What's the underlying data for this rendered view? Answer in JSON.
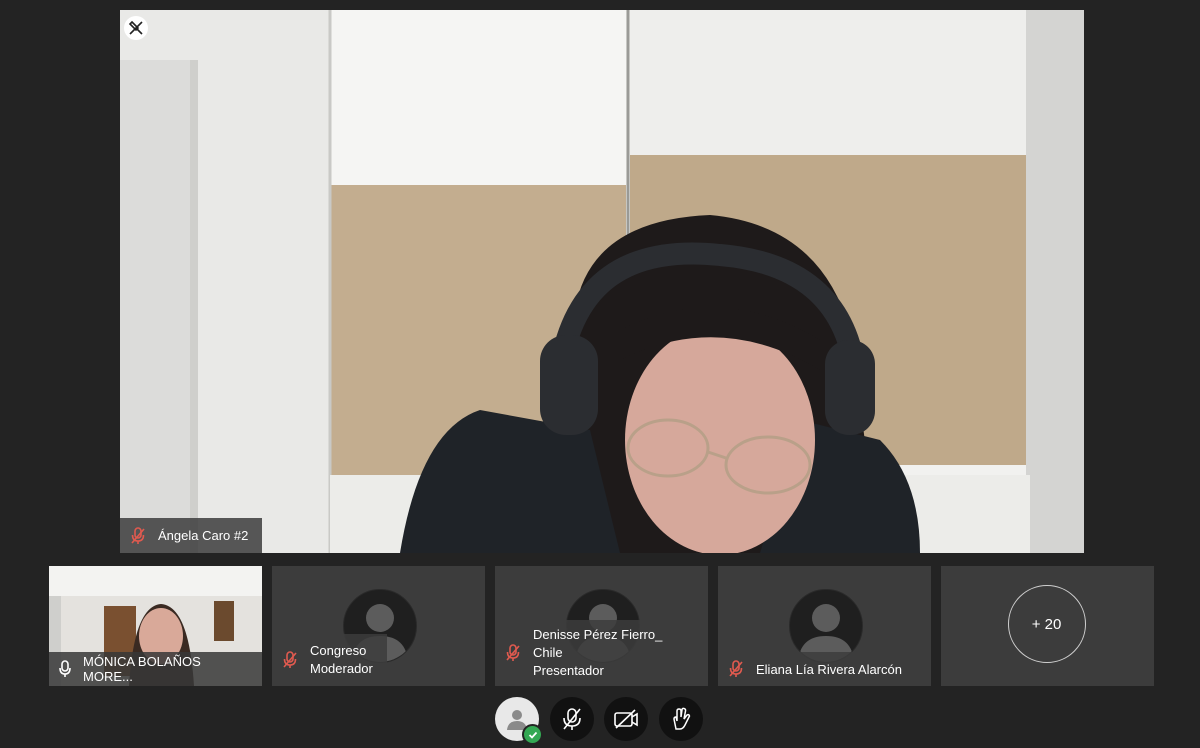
{
  "main_speaker": {
    "name": "Ángela Caro #2",
    "mic_muted": true
  },
  "participants": [
    {
      "name": "MÓNICA BOLAÑOS MORE...",
      "role": "",
      "mic_muted": false,
      "has_video": true
    },
    {
      "name": "Congreso",
      "role": "Moderador",
      "mic_muted": true,
      "has_video": false
    },
    {
      "name": "Denisse Pérez Fierro_ Chile",
      "role": "Presentador",
      "mic_muted": true,
      "has_video": false
    },
    {
      "name": "Eliana Lía Rivera Alarcón",
      "role": "",
      "mic_muted": true,
      "has_video": false
    }
  ],
  "more_participants": "+ 20",
  "controls": {
    "profile_icon": "user-icon",
    "mic_icon": "mic-off-icon",
    "camera_icon": "camera-off-icon",
    "hand_icon": "raise-hand-icon"
  },
  "colors": {
    "background": "#232323",
    "tile": "#3c3c3c",
    "muted_red": "#e05a4f",
    "ok_green": "#34a853"
  }
}
